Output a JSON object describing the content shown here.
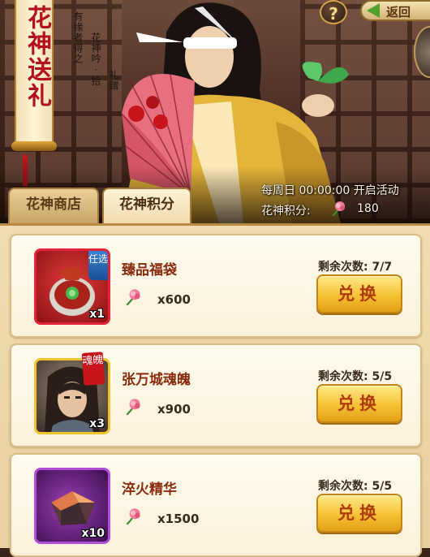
{
  "banner": {
    "title": "花神送礼",
    "poem": [
      "有缘者得之",
      "花神吟 · 拾",
      "礼赠"
    ]
  },
  "nav": {
    "help_label": "?",
    "back_label": "返回"
  },
  "event": {
    "schedule_text": "每周日 00:00:00 开启活动",
    "points_label": "花神积分:",
    "points_value": "180",
    "points_icon": "pink-flower-icon"
  },
  "tabs": [
    {
      "label": "花神商店",
      "selected": false
    },
    {
      "label": "花神积分",
      "selected": true
    }
  ],
  "items": [
    {
      "name": "臻品福袋",
      "quantity": "x1",
      "badge": "任选",
      "seal": "",
      "cost": "x600",
      "remaining_label": "剩余次数: 7/7",
      "button_label": "兑换",
      "rarity_color": "#e2233a",
      "icon": "lucky-bag-icon"
    },
    {
      "name": "张万城魂魄",
      "quantity": "x3",
      "badge": "",
      "seal": "魂魄",
      "cost": "x900",
      "remaining_label": "剩余次数: 5/5",
      "button_label": "兑换",
      "rarity_color": "#f0c22c",
      "icon": "hero-portrait-icon"
    },
    {
      "name": "淬火精华",
      "quantity": "x10",
      "badge": "",
      "seal": "",
      "cost": "x1500",
      "remaining_label": "剩余次数: 5/5",
      "button_label": "兑换",
      "rarity_color": "#b14ed6",
      "icon": "crystal-ore-icon"
    }
  ],
  "colors": {
    "accent_gold": "#f6c234",
    "title_red": "#b3121c",
    "panel_bg": "#f0dcb2"
  }
}
